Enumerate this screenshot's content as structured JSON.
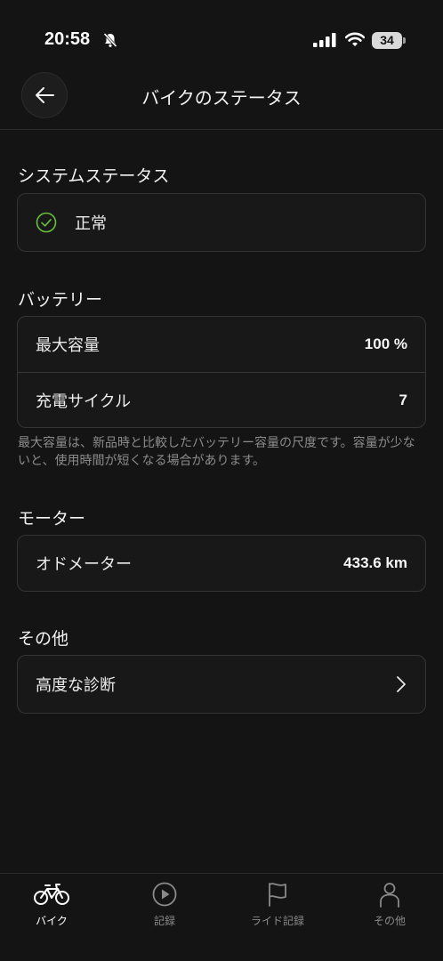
{
  "status_bar": {
    "time": "20:58",
    "battery": "34",
    "icons": [
      "bell-off-icon",
      "cellular-signal-icon",
      "wifi-icon",
      "battery-icon"
    ]
  },
  "header": {
    "title": "バイクのステータス",
    "back_icon": "arrow-left-icon"
  },
  "system_status": {
    "title": "システムステータス",
    "status_text": "正常",
    "status_icon": "check-circle-icon",
    "status_color": "#67c23a"
  },
  "battery": {
    "title": "バッテリー",
    "rows": [
      {
        "label": "最大容量",
        "value": "100 %"
      },
      {
        "label": "充電サイクル",
        "value": "7"
      }
    ],
    "note": "最大容量は、新品時と比較したバッテリー容量の尺度です。容量が少ないと、使用時間が短くなる場合があります。"
  },
  "motor": {
    "title": "モーター",
    "rows": [
      {
        "label": "オドメーター",
        "value": "433.6 km"
      }
    ]
  },
  "other": {
    "title": "その他",
    "rows": [
      {
        "label": "高度な診断",
        "icon": "chevron-right-icon"
      }
    ]
  },
  "tabbar": {
    "tabs": [
      {
        "label": "バイク",
        "icon": "bike-icon",
        "active": true
      },
      {
        "label": "記録",
        "icon": "play-circle-icon",
        "active": false
      },
      {
        "label": "ライド記録",
        "icon": "flag-icon",
        "active": false
      },
      {
        "label": "その他",
        "icon": "person-icon",
        "active": false
      }
    ]
  }
}
